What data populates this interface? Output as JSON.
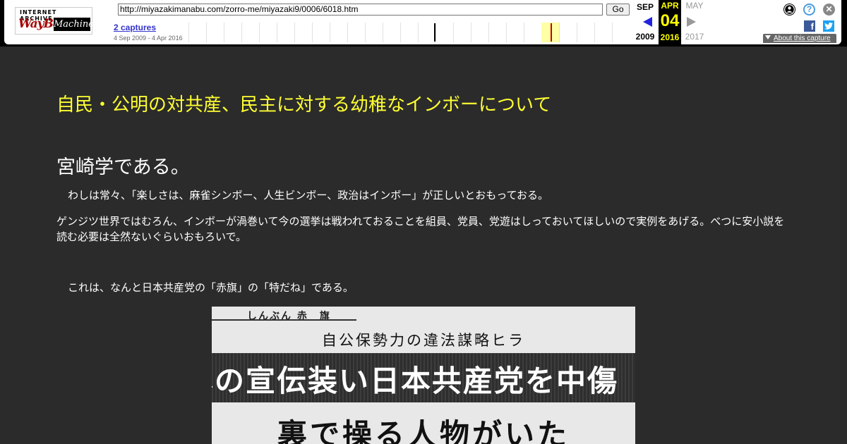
{
  "wayback": {
    "logo_top": "INTERNET ARCHIVE",
    "logo_wayback": "WayBack",
    "logo_machine": "Machine",
    "url": "http://miyazakimanabu.com/zorro-me/miyazaki9/0006/6018.htm",
    "go_label": "Go",
    "captures_label": "2 captures",
    "date_range": "4 Sep 2009 - 4 Apr 2016",
    "prev_month": "SEP",
    "current_month": "APR",
    "next_month": "MAY",
    "current_day": "04",
    "prev_year": "2009",
    "current_year": "2016",
    "next_year": "2017",
    "about_label": "About this capture",
    "facebook_glyph": "f",
    "twitter_glyph": "🐦",
    "login_icon": "person-circle-icon",
    "help_glyph": "?",
    "close_glyph": "✕",
    "colors": {
      "current_bg": "#000000",
      "current_fg": "#ffff00",
      "highlight": "#ffffa5",
      "capture_mark": "#cc0000",
      "link": "#3333cc"
    }
  },
  "article": {
    "headline": "自民・公明の対共産、民主に対する幼稚なインボーについて",
    "byline": "宮崎学である。",
    "para_1": "わしは常々、「楽しさは、麻雀シンボー、人生ビンボー、政治はインボー」が正しいとおもっておる。",
    "para_2": "ゲンジツ世界ではむろん、インボーが渦巻いて今の選挙は戦われておることを組員、党員、党遊はしっておいてほしいので実例をあげる。べつに安小説を読む必要は全然ないぐらいおもろいで。",
    "para_3": "これは、なんと日本共産党の「赤旗」の「特だね」である。",
    "colors": {
      "headline": "#ffff33",
      "body": "#ffffff",
      "background": "#2b2b2b"
    }
  },
  "clipping": {
    "masthead": "しんぶん 赤　旗",
    "subhead": "自公保勢力の違法謀略ヒラ",
    "headline_1": "本の宣伝装い日本共産党を中傷",
    "headline_2": "裏で操る人物がいた"
  }
}
